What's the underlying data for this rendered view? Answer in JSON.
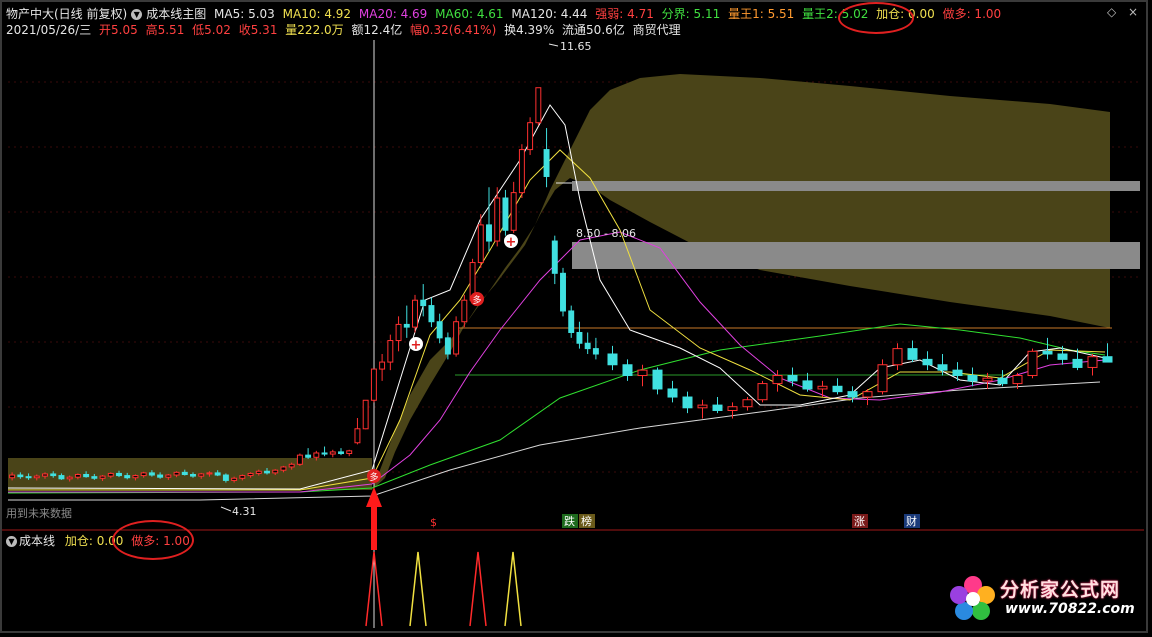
{
  "header": {
    "stock": "物产中大(日线 前复权)",
    "indicator": "成本线主图",
    "ma5": "MA5: 5.03",
    "ma10": "MA10: 4.92",
    "ma20": "MA20: 4.69",
    "ma60": "MA60: 4.61",
    "ma120": "MA120: 4.44",
    "qiangruo": "强弱: 4.71",
    "fenjie": "分界: 5.11",
    "liangwang1": "量王1: 5.51",
    "liangwang2": "量王2: 5.02",
    "jiacang": "加仓: 0.00",
    "zuoduo": "做多: 1.00"
  },
  "quote": {
    "date": "2021/05/26/三",
    "open": "开5.05",
    "high": "高5.51",
    "low": "低5.02",
    "close": "收5.31",
    "volume": "量222.0万",
    "amount": "额12.4亿",
    "change": "幅0.32(6.41%)",
    "turnover": "换4.39%",
    "float": "流通50.6亿",
    "sector": "商贸代理"
  },
  "chart_labels": {
    "peak": "11.65",
    "bottom": "4.31",
    "range": "8.50 - 8.06",
    "future_data": "用到未来数据",
    "marker_duo": "多",
    "marker_plus": "+",
    "tag_dollar": "$",
    "tag_die": "跌",
    "tag_bang": "榜",
    "tag_zhang": "涨",
    "tag_cai": "财"
  },
  "sub_panel": {
    "title": "成本线",
    "jiacang": "加仓: 0.00",
    "zuoduo": "做多: 1.00"
  },
  "window_buttons": {
    "diamond": "◇",
    "close": "×"
  },
  "logo": {
    "name": "分析家公式网",
    "url": "www.70822.com"
  },
  "chart_data": {
    "type": "candlestick",
    "ylim": [
      3.8,
      12.5
    ],
    "candles": [
      [
        4.4,
        4.5,
        4.35,
        4.45
      ],
      [
        4.45,
        4.5,
        4.38,
        4.42
      ],
      [
        4.42,
        4.48,
        4.36,
        4.4
      ],
      [
        4.4,
        4.46,
        4.35,
        4.43
      ],
      [
        4.43,
        4.5,
        4.38,
        4.47
      ],
      [
        4.47,
        4.52,
        4.4,
        4.44
      ],
      [
        4.44,
        4.48,
        4.36,
        4.38
      ],
      [
        4.38,
        4.44,
        4.33,
        4.41
      ],
      [
        4.41,
        4.48,
        4.37,
        4.46
      ],
      [
        4.46,
        4.52,
        4.4,
        4.42
      ],
      [
        4.42,
        4.47,
        4.36,
        4.39
      ],
      [
        4.39,
        4.45,
        4.34,
        4.43
      ],
      [
        4.43,
        4.5,
        4.39,
        4.48
      ],
      [
        4.48,
        4.53,
        4.41,
        4.44
      ],
      [
        4.44,
        4.49,
        4.37,
        4.4
      ],
      [
        4.4,
        4.46,
        4.35,
        4.44
      ],
      [
        4.44,
        4.51,
        4.4,
        4.49
      ],
      [
        4.49,
        4.54,
        4.42,
        4.45
      ],
      [
        4.45,
        4.5,
        4.38,
        4.41
      ],
      [
        4.41,
        4.47,
        4.36,
        4.45
      ],
      [
        4.45,
        4.52,
        4.41,
        4.5
      ],
      [
        4.5,
        4.55,
        4.44,
        4.46
      ],
      [
        4.46,
        4.5,
        4.4,
        4.43
      ],
      [
        4.43,
        4.49,
        4.38,
        4.47
      ],
      [
        4.47,
        4.52,
        4.42,
        4.49
      ],
      [
        4.49,
        4.54,
        4.43,
        4.45
      ],
      [
        4.45,
        4.48,
        4.31,
        4.35
      ],
      [
        4.35,
        4.42,
        4.31,
        4.39
      ],
      [
        4.39,
        4.46,
        4.35,
        4.44
      ],
      [
        4.44,
        4.5,
        4.4,
        4.48
      ],
      [
        4.48,
        4.55,
        4.44,
        4.52
      ],
      [
        4.52,
        4.58,
        4.46,
        4.49
      ],
      [
        4.49,
        4.56,
        4.45,
        4.54
      ],
      [
        4.54,
        4.62,
        4.5,
        4.6
      ],
      [
        4.6,
        4.68,
        4.55,
        4.65
      ],
      [
        4.65,
        4.85,
        4.62,
        4.82
      ],
      [
        4.82,
        4.95,
        4.75,
        4.78
      ],
      [
        4.78,
        4.9,
        4.72,
        4.86
      ],
      [
        4.86,
        4.98,
        4.8,
        4.84
      ],
      [
        4.84,
        4.92,
        4.78,
        4.88
      ],
      [
        4.88,
        4.95,
        4.82,
        4.85
      ],
      [
        4.85,
        4.92,
        4.8,
        4.9
      ],
      [
        5.05,
        5.51,
        5.02,
        5.31
      ],
      [
        5.31,
        5.84,
        5.3,
        5.84
      ],
      [
        5.84,
        6.42,
        5.8,
        6.42
      ],
      [
        6.42,
        6.7,
        6.2,
        6.55
      ],
      [
        6.55,
        7.06,
        6.4,
        6.95
      ],
      [
        6.95,
        7.4,
        6.75,
        7.25
      ],
      [
        7.25,
        7.6,
        7.0,
        7.2
      ],
      [
        7.2,
        7.8,
        7.1,
        7.7
      ],
      [
        7.7,
        8.0,
        7.4,
        7.6
      ],
      [
        7.6,
        7.75,
        7.2,
        7.3
      ],
      [
        7.3,
        7.45,
        6.9,
        7.0
      ],
      [
        7.0,
        7.1,
        6.6,
        6.7
      ],
      [
        6.7,
        7.4,
        6.65,
        7.3
      ],
      [
        7.3,
        7.8,
        7.2,
        7.7
      ],
      [
        7.7,
        8.47,
        7.65,
        8.4
      ],
      [
        8.4,
        9.3,
        8.3,
        9.1
      ],
      [
        9.1,
        9.8,
        8.6,
        8.8
      ],
      [
        8.8,
        9.8,
        8.7,
        9.6
      ],
      [
        9.6,
        9.75,
        8.9,
        9.0
      ],
      [
        9.0,
        9.9,
        8.95,
        9.7
      ],
      [
        9.7,
        10.6,
        9.6,
        10.5
      ],
      [
        10.5,
        11.1,
        10.4,
        11.0
      ],
      [
        11.0,
        11.65,
        10.95,
        11.65
      ],
      [
        10.5,
        10.9,
        9.8,
        10.0
      ],
      [
        8.8,
        8.9,
        8.0,
        8.2
      ],
      [
        8.2,
        8.3,
        7.4,
        7.5
      ],
      [
        7.5,
        7.6,
        7.0,
        7.1
      ],
      [
        7.1,
        7.3,
        6.8,
        6.9
      ],
      [
        6.9,
        7.1,
        6.7,
        6.8
      ],
      [
        6.8,
        7.0,
        6.6,
        6.7
      ]
    ],
    "series": []
  }
}
